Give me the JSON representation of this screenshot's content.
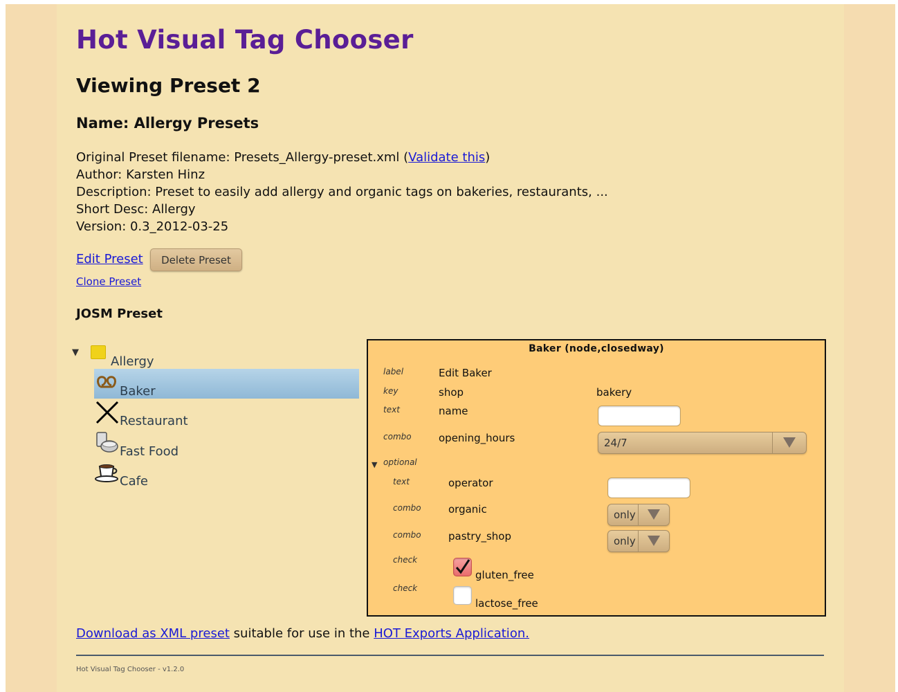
{
  "page": {
    "title": "Hot Visual Tag Chooser",
    "subtitle": "Viewing Preset 2",
    "name_line": "Name: Allergy Presets"
  },
  "meta": {
    "filename_prefix": "Original Preset filename: Presets_Allergy-preset.xml (",
    "validate_link": "Validate this",
    "filename_suffix": ")",
    "author": "Author: Karsten Hinz",
    "description": "Description: Preset to easily add allergy and organic tags on bakeries, restaurants, ...",
    "short_desc": "Short Desc: Allergy",
    "version": "Version: 0.3_2012-03-25"
  },
  "actions": {
    "edit_label": "Edit Preset",
    "delete_label": "Delete Preset",
    "clone_label": "Clone Preset"
  },
  "josm_heading": "JOSM Preset",
  "tree": {
    "group": "Allergy",
    "items": [
      "Baker",
      "Restaurant",
      "Fast Food",
      "Cafe"
    ],
    "selected": "Baker"
  },
  "panel": {
    "title": "Baker (node,closedway)",
    "rows": {
      "label": {
        "type": "label",
        "value": "Edit Baker"
      },
      "key": {
        "type": "key",
        "name": "shop",
        "value": "bakery"
      },
      "text": {
        "type": "text",
        "name": "name"
      },
      "combo": {
        "type": "combo",
        "name": "opening_hours",
        "value": "24/7"
      },
      "optional": {
        "type": "optional"
      },
      "operator": {
        "type": "text",
        "name": "operator"
      },
      "organic": {
        "type": "combo",
        "name": "organic",
        "value": "only"
      },
      "pastry": {
        "type": "combo",
        "name": "pastry_shop",
        "value": "only"
      },
      "gluten": {
        "type": "check",
        "name": "gluten_free",
        "checked": true
      },
      "lactose": {
        "type": "check",
        "name": "lactose_free",
        "checked": false
      }
    }
  },
  "download": {
    "link": "Download as XML preset",
    "middle": " suitable for use in the ",
    "hot_link": "HOT Exports Application."
  },
  "footer": "Hot Visual Tag Chooser - v1.2.0",
  "colors": {
    "title": "#5a1e96",
    "link": "#1a1ad6",
    "panel_bg": "#fecc78",
    "page_bg": "#f5e3b2"
  }
}
